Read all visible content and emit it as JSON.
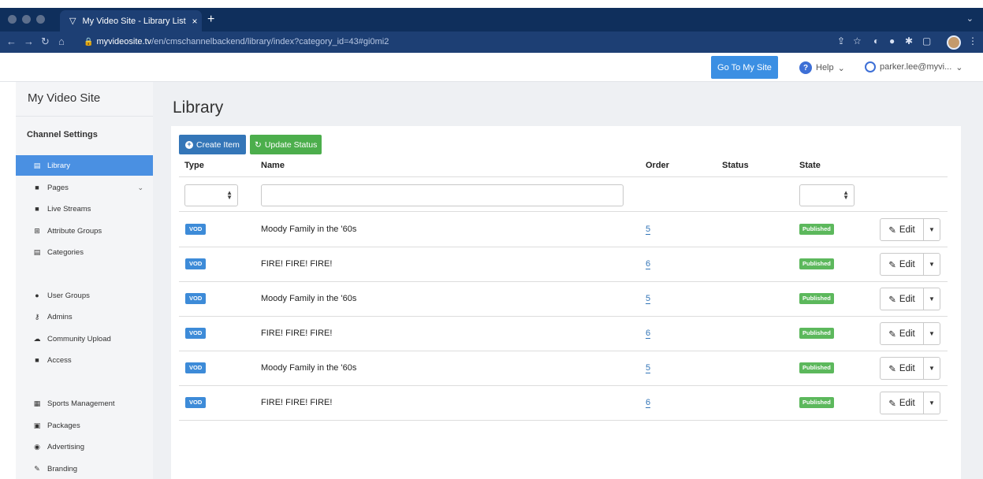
{
  "browser": {
    "tab_title": "My Video Site - Library List",
    "tab_close": "×",
    "new_tab": "+",
    "url_host": "myvideosite.tv",
    "url_path": "/en/cmschannelbackend/library/index?category_id=43#gi0mi2"
  },
  "header": {
    "goto_label": "Go To My Site",
    "help_label": "Help",
    "user_label": "parker.lee@myvi..."
  },
  "sidebar": {
    "title": "My Video Site",
    "section": "Channel Settings",
    "items": [
      {
        "label": "Library",
        "icon": "film-icon",
        "glyph": "▤"
      },
      {
        "label": "Pages",
        "icon": "file-icon",
        "glyph": "■"
      },
      {
        "label": "Live Streams",
        "icon": "video-camera-icon",
        "glyph": "■"
      },
      {
        "label": "Attribute Groups",
        "icon": "sitemap-icon",
        "glyph": "⊞"
      },
      {
        "label": "Categories",
        "icon": "list-icon",
        "glyph": "▤"
      },
      {
        "label": "User Groups",
        "icon": "users-icon",
        "glyph": "●"
      },
      {
        "label": "Admins",
        "icon": "key-icon",
        "glyph": "⚷"
      },
      {
        "label": "Community Upload",
        "icon": "cloud-upload-icon",
        "glyph": "☁"
      },
      {
        "label": "Access",
        "icon": "lock-icon",
        "glyph": "■"
      },
      {
        "label": "Sports Management",
        "icon": "calendar-icon",
        "glyph": "▦"
      },
      {
        "label": "Packages",
        "icon": "money-icon",
        "glyph": "▣"
      },
      {
        "label": "Advertising",
        "icon": "eye-icon",
        "glyph": "◉"
      },
      {
        "label": "Branding",
        "icon": "brush-icon",
        "glyph": "✎"
      }
    ]
  },
  "main": {
    "title": "Library",
    "create_label": "Create Item",
    "update_label": "Update Status",
    "columns": {
      "type": "Type",
      "name": "Name",
      "order": "Order",
      "status": "Status",
      "state": "State"
    },
    "rows": [
      {
        "type": "VOD",
        "name": "Moody Family in the '60s",
        "order": "5",
        "state": "Published",
        "edit": "Edit"
      },
      {
        "type": "VOD",
        "name": "FIRE! FIRE! FIRE!",
        "order": "6",
        "state": "Published",
        "edit": "Edit"
      },
      {
        "type": "VOD",
        "name": "Moody Family in the '60s",
        "order": "5",
        "state": "Published",
        "edit": "Edit"
      },
      {
        "type": "VOD",
        "name": "FIRE! FIRE! FIRE!",
        "order": "6",
        "state": "Published",
        "edit": "Edit"
      },
      {
        "type": "VOD",
        "name": "Moody Family in the '60s",
        "order": "5",
        "state": "Published",
        "edit": "Edit"
      },
      {
        "type": "VOD",
        "name": "FIRE! FIRE! FIRE!",
        "order": "6",
        "state": "Published",
        "edit": "Edit"
      }
    ]
  },
  "colors": {
    "chrome_dark": "#0f2f5c",
    "chrome_bar": "#1d3f74",
    "accent_blue": "#3b8fe3",
    "active_nav": "#4a90e2",
    "success_green": "#4cae4c"
  }
}
